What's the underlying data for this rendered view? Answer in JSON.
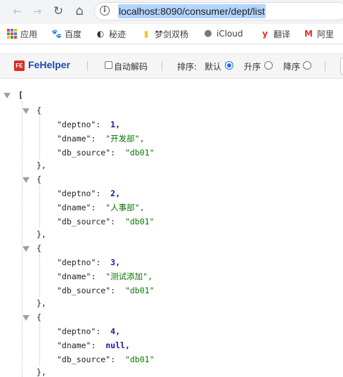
{
  "nav": {
    "back_icon": "←",
    "forward_icon": "→",
    "reload_icon": "↻",
    "home_icon": "⌂"
  },
  "address_bar": {
    "url": "localhost:8090/consumer/dept/list",
    "info_glyph": "i"
  },
  "bookmarks": [
    {
      "label": "应用",
      "icon": "apps-grid-icon"
    },
    {
      "label": "百度",
      "icon": "baidu-paw-icon",
      "color": "#2932e1",
      "glyph": "🐾"
    },
    {
      "label": "秘迹",
      "icon": "mijisousuo-icon",
      "color": "#333333",
      "glyph": "◐"
    },
    {
      "label": "梦剑双杨",
      "icon": "folder-icon",
      "color": "#f5c12e",
      "glyph": "▮"
    },
    {
      "label": "iCloud",
      "icon": "apple-icon",
      "color": "#7a7a7a",
      "glyph": ""
    },
    {
      "label": "翻译",
      "icon": "youdao-icon",
      "color": "#e0302a",
      "glyph": "y"
    },
    {
      "label": "阿里",
      "icon": "alibaba-icon",
      "color": "#e0302a",
      "glyph": "M"
    }
  ],
  "fehelper": {
    "logo_text": "FE",
    "title": "FeHelper",
    "auto_decode_label": "自动解码",
    "sort_label": "排序:",
    "sort_options": [
      {
        "label": "默认",
        "selected": true
      },
      {
        "label": "升序",
        "selected": false
      },
      {
        "label": "降序",
        "selected": false
      }
    ]
  },
  "json": {
    "open_bracket": "[",
    "object_open": "{",
    "object_close": "},",
    "key_deptno": "\"deptno\":",
    "key_dname": "\"dname\":",
    "key_db_source": "\"db_source\":",
    "items": [
      {
        "deptno": "1,",
        "dname": "\"开发部\",",
        "db_source": "\"db01\""
      },
      {
        "deptno": "2,",
        "dname": "\"人事部\",",
        "db_source": "\"db01\""
      },
      {
        "deptno": "3,",
        "dname": "\"测试添加\",",
        "db_source": "\"db01\""
      },
      {
        "deptno": "4,",
        "dname": "null,",
        "db_source": "\"db01\""
      }
    ]
  }
}
